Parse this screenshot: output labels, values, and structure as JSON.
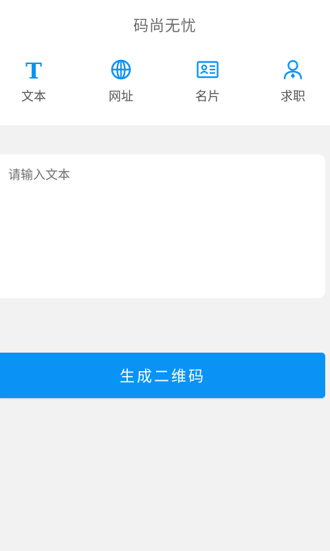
{
  "app": {
    "title": "码尚无忧"
  },
  "tabs": [
    {
      "label": "文本",
      "icon": "text-icon"
    },
    {
      "label": "网址",
      "icon": "globe-icon"
    },
    {
      "label": "名片",
      "icon": "id-card-icon"
    },
    {
      "label": "求职",
      "icon": "person-icon"
    }
  ],
  "input": {
    "placeholder": "请输入文本",
    "value": ""
  },
  "actions": {
    "generate_label": "生成二维码"
  },
  "colors": {
    "accent": "#0a93f5",
    "background": "#f2f2f2",
    "surface": "#ffffff"
  }
}
